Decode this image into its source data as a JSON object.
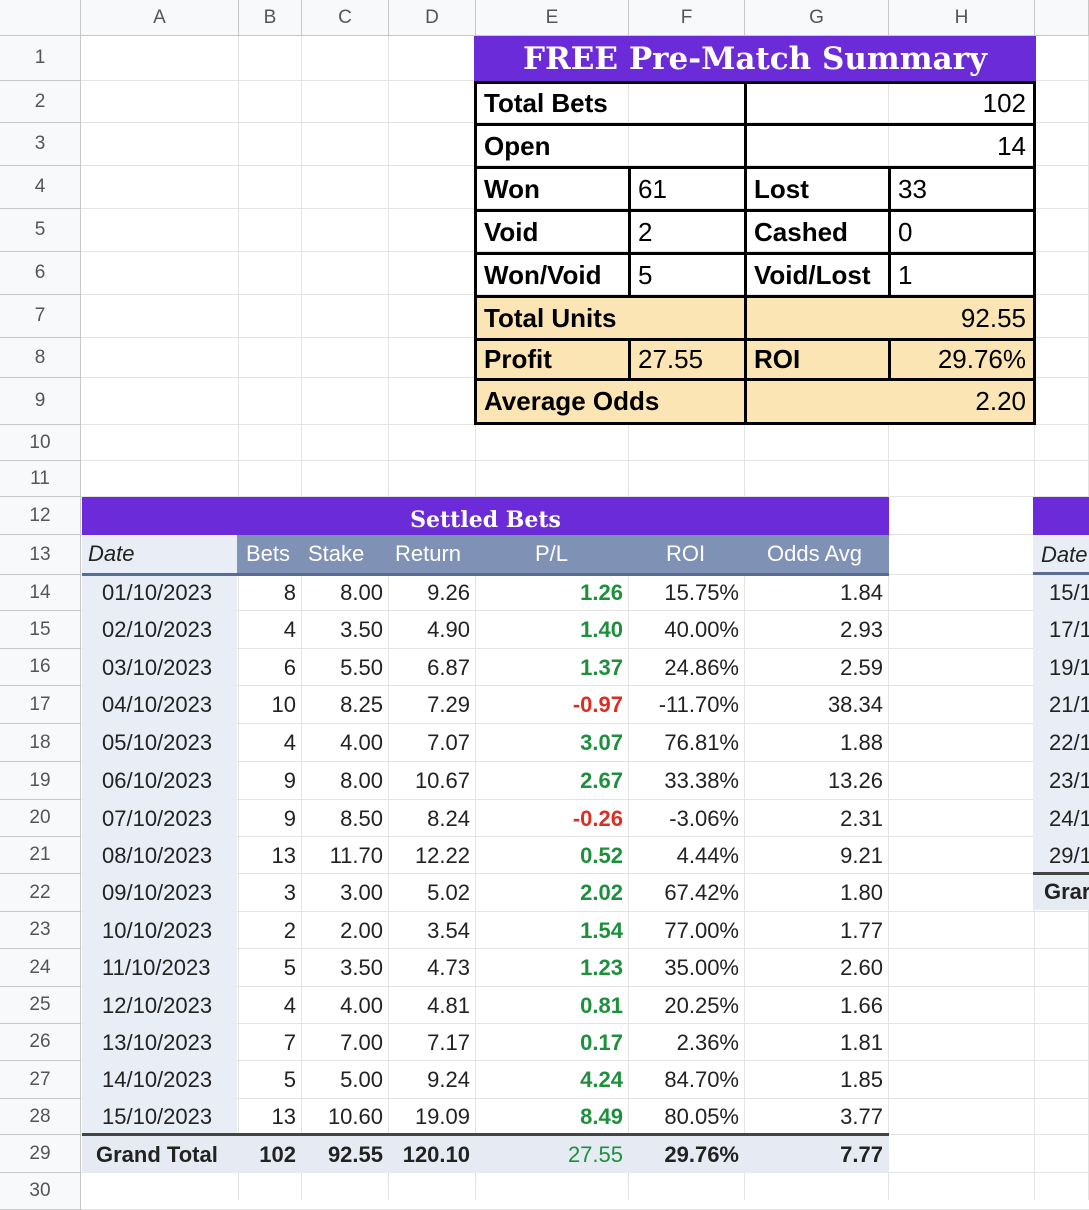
{
  "columns": [
    "A",
    "B",
    "C",
    "D",
    "E",
    "F",
    "G",
    "H"
  ],
  "rows": [
    "1",
    "2",
    "3",
    "4",
    "5",
    "6",
    "7",
    "8",
    "9",
    "10",
    "11",
    "12",
    "13",
    "14",
    "15",
    "16",
    "17",
    "18",
    "19",
    "20",
    "21",
    "22",
    "23",
    "24",
    "25",
    "26",
    "27",
    "28",
    "29",
    "30"
  ],
  "summary": {
    "title": "FREE Pre-Match Summary",
    "total_bets_label": "Total Bets",
    "total_bets": "102",
    "open_label": "Open",
    "open": "14",
    "won_label": "Won",
    "won": "61",
    "lost_label": "Lost",
    "lost": "33",
    "void_label": "Void",
    "void": "2",
    "cashed_label": "Cashed",
    "cashed": "0",
    "wonvoid_label": "Won/Void",
    "wonvoid": "5",
    "voidlost_label": "Void/Lost",
    "voidlost": "1",
    "total_units_label": "Total Units",
    "total_units": "92.55",
    "profit_label": "Profit",
    "profit": "27.55",
    "roi_label": "ROI",
    "roi": "29.76%",
    "avg_odds_label": "Average Odds",
    "avg_odds": "2.20"
  },
  "settled": {
    "title": "Settled Bets",
    "headers": [
      "Date",
      "Bets",
      "Stake",
      "Return",
      "P/L",
      "ROI",
      "Odds Avg"
    ],
    "rows": [
      {
        "date": "01/10/2023",
        "bets": "8",
        "stake": "8.00",
        "ret": "9.26",
        "pl": "1.26",
        "roi": "15.75%",
        "odds": "1.84",
        "sign": "pos"
      },
      {
        "date": "02/10/2023",
        "bets": "4",
        "stake": "3.50",
        "ret": "4.90",
        "pl": "1.40",
        "roi": "40.00%",
        "odds": "2.93",
        "sign": "pos"
      },
      {
        "date": "03/10/2023",
        "bets": "6",
        "stake": "5.50",
        "ret": "6.87",
        "pl": "1.37",
        "roi": "24.86%",
        "odds": "2.59",
        "sign": "pos"
      },
      {
        "date": "04/10/2023",
        "bets": "10",
        "stake": "8.25",
        "ret": "7.29",
        "pl": "-0.97",
        "roi": "-11.70%",
        "odds": "38.34",
        "sign": "neg"
      },
      {
        "date": "05/10/2023",
        "bets": "4",
        "stake": "4.00",
        "ret": "7.07",
        "pl": "3.07",
        "roi": "76.81%",
        "odds": "1.88",
        "sign": "pos"
      },
      {
        "date": "06/10/2023",
        "bets": "9",
        "stake": "8.00",
        "ret": "10.67",
        "pl": "2.67",
        "roi": "33.38%",
        "odds": "13.26",
        "sign": "pos"
      },
      {
        "date": "07/10/2023",
        "bets": "9",
        "stake": "8.50",
        "ret": "8.24",
        "pl": "-0.26",
        "roi": "-3.06%",
        "odds": "2.31",
        "sign": "neg"
      },
      {
        "date": "08/10/2023",
        "bets": "13",
        "stake": "11.70",
        "ret": "12.22",
        "pl": "0.52",
        "roi": "4.44%",
        "odds": "9.21",
        "sign": "pos"
      },
      {
        "date": "09/10/2023",
        "bets": "3",
        "stake": "3.00",
        "ret": "5.02",
        "pl": "2.02",
        "roi": "67.42%",
        "odds": "1.80",
        "sign": "pos"
      },
      {
        "date": "10/10/2023",
        "bets": "2",
        "stake": "2.00",
        "ret": "3.54",
        "pl": "1.54",
        "roi": "77.00%",
        "odds": "1.77",
        "sign": "pos"
      },
      {
        "date": "11/10/2023",
        "bets": "5",
        "stake": "3.50",
        "ret": "4.73",
        "pl": "1.23",
        "roi": "35.00%",
        "odds": "2.60",
        "sign": "pos"
      },
      {
        "date": "12/10/2023",
        "bets": "4",
        "stake": "4.00",
        "ret": "4.81",
        "pl": "0.81",
        "roi": "20.25%",
        "odds": "1.66",
        "sign": "pos"
      },
      {
        "date": "13/10/2023",
        "bets": "7",
        "stake": "7.00",
        "ret": "7.17",
        "pl": "0.17",
        "roi": "2.36%",
        "odds": "1.81",
        "sign": "pos"
      },
      {
        "date": "14/10/2023",
        "bets": "5",
        "stake": "5.00",
        "ret": "9.24",
        "pl": "4.24",
        "roi": "84.70%",
        "odds": "1.85",
        "sign": "pos"
      },
      {
        "date": "15/10/2023",
        "bets": "13",
        "stake": "10.60",
        "ret": "19.09",
        "pl": "8.49",
        "roi": "80.05%",
        "odds": "3.77",
        "sign": "pos"
      }
    ],
    "grand_total": {
      "label": "Grand Total",
      "bets": "102",
      "stake": "92.55",
      "ret": "120.10",
      "pl": "27.55",
      "roi": "29.76%",
      "odds": "7.77"
    }
  },
  "right_table": {
    "header": "Date",
    "dates": [
      "15/1",
      "17/1",
      "19/1",
      "21/1",
      "22/1",
      "23/1",
      "24/1",
      "29/1"
    ],
    "grand_label": "Grar"
  }
}
